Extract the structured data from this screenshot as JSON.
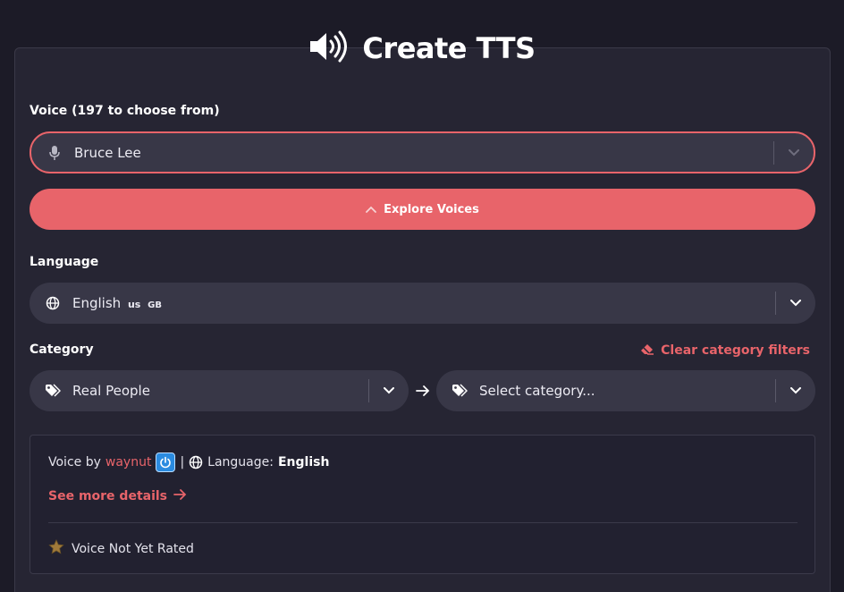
{
  "header": {
    "title": "Create TTS",
    "icon": "speaker-loud-icon"
  },
  "voice": {
    "label": "Voice (197 to choose from)",
    "selected": "Bruce Lee",
    "icon": "microphone-icon",
    "accent": "#e8646a"
  },
  "explore_button": {
    "label": "Explore Voices",
    "icon": "chevron-up-icon"
  },
  "language": {
    "label": "Language",
    "selected": "English",
    "tags": [
      "us",
      "GB"
    ],
    "icon": "globe-icon"
  },
  "category": {
    "label": "Category",
    "clear_label": "Clear category filters",
    "clear_icon": "eraser-icon",
    "primary": {
      "selected": "Real People",
      "icon": "tags-icon"
    },
    "secondary": {
      "placeholder": "Select category...",
      "icon": "tags-icon"
    }
  },
  "details": {
    "voice_by_prefix": "Voice by",
    "author": "waynut",
    "author_badge_icon": "power-badge-icon",
    "separator": "|",
    "language_prefix": "Language:",
    "language_value": "English",
    "see_more_label": "See more details",
    "rating_label": "Voice Not Yet Rated",
    "rating_icon": "star-icon"
  },
  "colors": {
    "background": "#1c1b27",
    "panel": "#262533",
    "accent": "#e8646a",
    "field": "#383747"
  }
}
